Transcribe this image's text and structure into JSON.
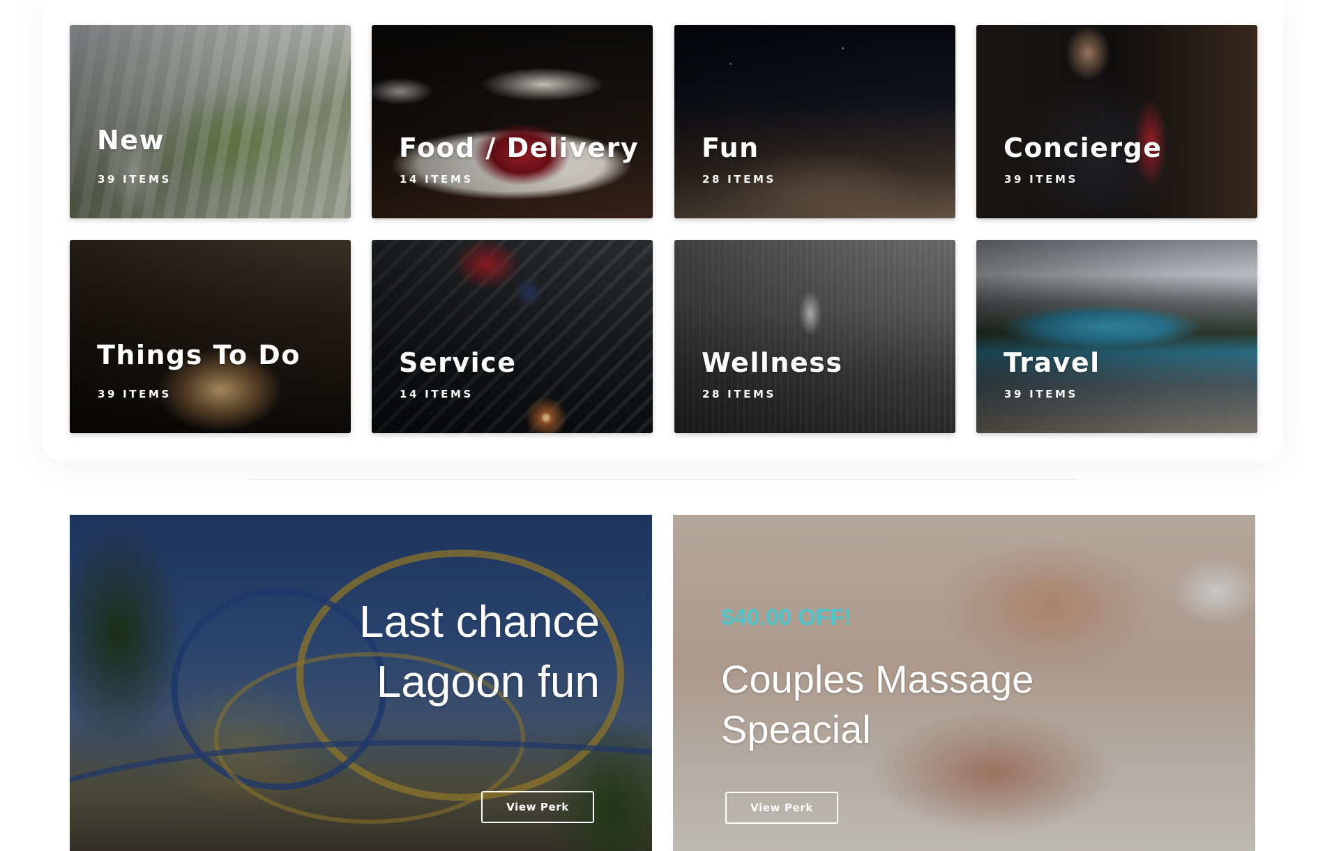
{
  "categories": [
    {
      "title": "New",
      "count": "39",
      "count_unit": "ITEMS"
    },
    {
      "title": "Food / Delivery",
      "count": "14",
      "count_unit": "ITEMS"
    },
    {
      "title": "Fun",
      "count": "28",
      "count_unit": "ITEMS"
    },
    {
      "title": "Concierge",
      "count": "39",
      "count_unit": "ITEMS"
    },
    {
      "title": "Things To Do",
      "count": "39",
      "count_unit": "ITEMS"
    },
    {
      "title": "Service",
      "count": "14",
      "count_unit": "ITEMS"
    },
    {
      "title": "Wellness",
      "count": "28",
      "count_unit": "ITEMS"
    },
    {
      "title": "Travel",
      "count": "39",
      "count_unit": "ITEMS"
    }
  ],
  "promos": [
    {
      "heading_line1": "Last chance",
      "heading_line2": "Lagoon fun",
      "button_label": "View Perk"
    },
    {
      "discount": "$40.00 OFF!",
      "heading_line1": "Couples Massage",
      "heading_line2": "Speacial",
      "button_label": "View Perk"
    }
  ],
  "colors": {
    "accent_teal": "#4fc6c9",
    "card_text": "#ffffff",
    "page_background": "#ffffff"
  }
}
